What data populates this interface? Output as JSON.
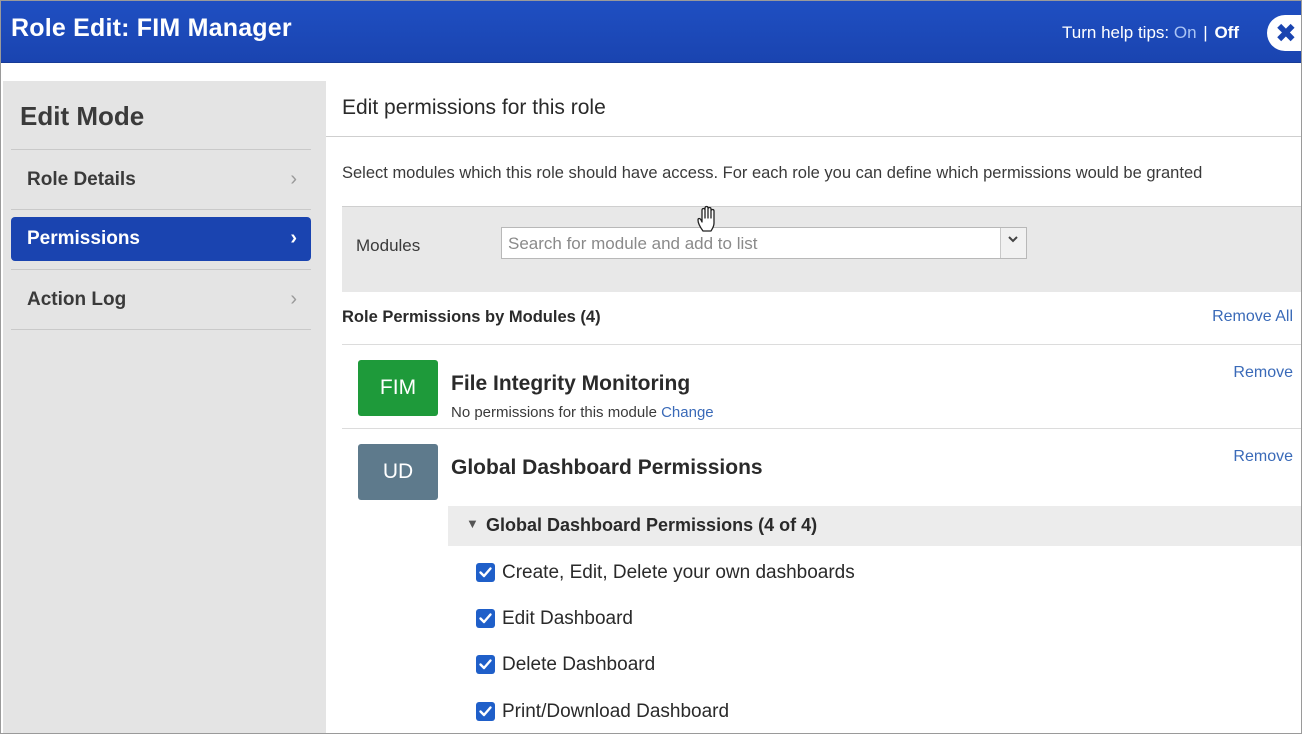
{
  "window": {
    "title": "Role Edit: FIM Manager",
    "help_label": "Turn help tips:",
    "help_on": "On",
    "help_separator": "|",
    "help_off": "Off",
    "close_glyph": "✖"
  },
  "sidebar": {
    "heading": "Edit Mode",
    "items": [
      {
        "label": "Role Details",
        "active": false
      },
      {
        "label": "Permissions",
        "active": true
      },
      {
        "label": "Action Log",
        "active": false
      }
    ],
    "chevron": "›"
  },
  "main": {
    "heading": "Edit permissions for this role",
    "description": "Select modules which this role should have access. For each role you can define which permissions would be granted",
    "modules_label": "Modules",
    "modules_search_placeholder": "Search for module and add to list",
    "permissions_title": "Role Permissions by Modules (4)",
    "remove_all_label": "Remove All",
    "modules": [
      {
        "badge": "FIM",
        "badge_color": "#1e9a3a",
        "name": "File Integrity Monitoring",
        "sub_text": "No permissions for this module",
        "sub_link": "Change",
        "remove_label": "Remove"
      },
      {
        "badge": "UD",
        "badge_color": "#5e7a8c",
        "name": "Global Dashboard Permissions",
        "remove_label": "Remove",
        "group": {
          "name": "Global Dashboard Permissions (4 of 4)",
          "permissions": [
            {
              "label": "Create, Edit, Delete your own dashboards",
              "checked": true
            },
            {
              "label": "Edit Dashboard",
              "checked": true
            },
            {
              "label": "Delete Dashboard",
              "checked": true
            },
            {
              "label": "Print/Download Dashboard",
              "checked": true
            }
          ]
        }
      }
    ]
  },
  "colors": {
    "header_blue": "#1a44b0",
    "link_blue": "#3a6ab8",
    "checkbox_blue": "#1f5fc9"
  }
}
